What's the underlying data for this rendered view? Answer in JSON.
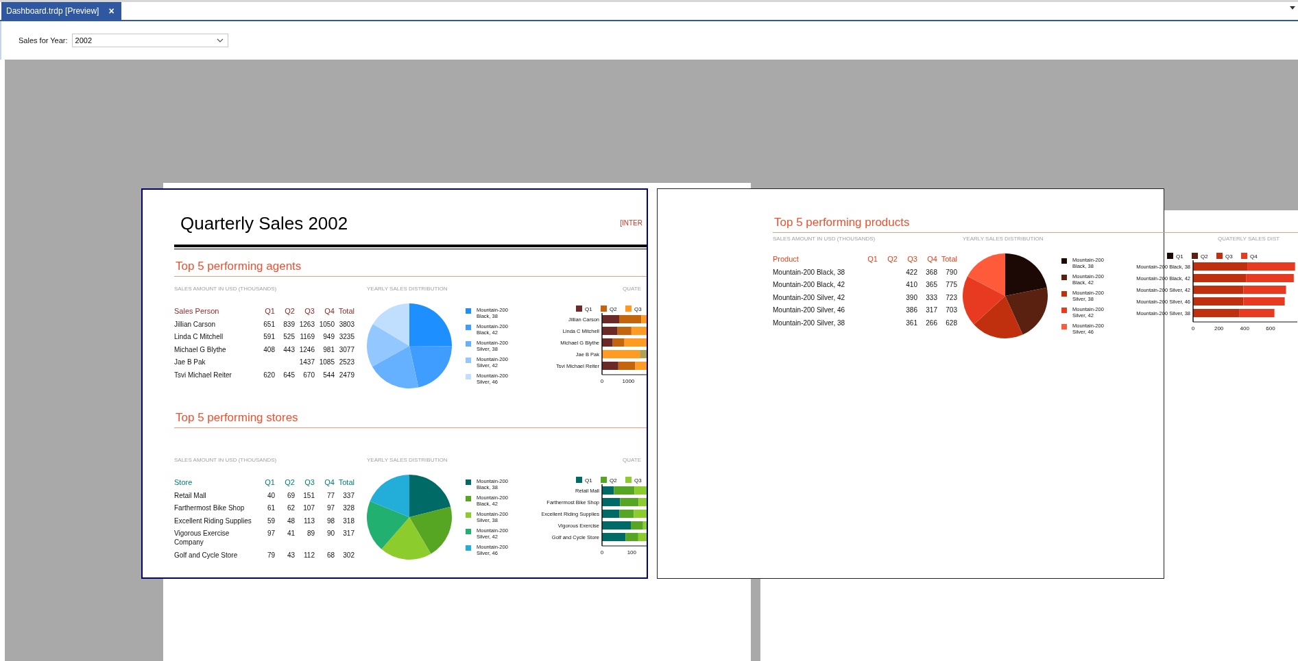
{
  "tab": {
    "label": "Dashboard.trdp [Preview]",
    "close": "×"
  },
  "parameter": {
    "label": "Sales for Year:",
    "value": "2002"
  },
  "page_1": {
    "title": "Quarterly Sales 2002",
    "stamp": "[INTER",
    "sections": [
      {
        "title": "Top 5 performing agents",
        "color": "#8b2a2a",
        "table_caption": "SALES AMOUNT IN USD (THOUSANDS)",
        "columns": [
          "Sales Person",
          "Q1",
          "Q2",
          "Q3",
          "Q4",
          "Total"
        ],
        "rows": [
          {
            "cells": [
              "Jillian  Carson",
              "651",
              "839",
              "1263",
              "1050",
              "3803"
            ]
          },
          {
            "cells": [
              "Linda C Mitchell",
              "591",
              "525",
              "1169",
              "949",
              "3235"
            ]
          },
          {
            "cells": [
              "Michael G Blythe",
              "408",
              "443",
              "1246",
              "981",
              "3077"
            ]
          },
          {
            "cells": [
              "Jae B Pak",
              null,
              null,
              "1437",
              "1085",
              "2523"
            ]
          },
          {
            "cells": [
              "Tsvi Michael Reiter",
              "620",
              "645",
              "670",
              "544",
              "2479"
            ]
          }
        ],
        "pie_caption": "YEARLY SALES DISTRIBUTION",
        "legend": [
          {
            "label": "Mountain-200 Black, 38",
            "color": "#1e8fff"
          },
          {
            "label": "Mountain-200 Black, 42",
            "color": "#3f9dff"
          },
          {
            "label": "Mountain-200 Silver, 38",
            "color": "#66b1ff"
          },
          {
            "label": "Mountain-200 Silver, 42",
            "color": "#92c7ff"
          },
          {
            "label": "Mountain-200 Silver, 46",
            "color": "#c0dfff"
          }
        ],
        "bar_caption": "QUATE",
        "bar_chart": {
          "categories": [
            "Jillian Carson",
            "Linda C Mitchell",
            "Michael G Blythe",
            "Jae B Pak",
            "Tsvi Michael Reiter"
          ],
          "ticks": [
            "0",
            "1000"
          ],
          "series": [
            {
              "name": "Q1",
              "color": "#6b2a28"
            },
            {
              "name": "Q2",
              "color": "#c2650c"
            },
            {
              "name": "Q3",
              "color": "#ff9a22"
            },
            {
              "color": "#b0a052"
            }
          ]
        }
      },
      {
        "title": "Top 5 performing stores",
        "color": "#007b78",
        "table_caption": "SALES AMOUNT IN USD (THOUSANDS)",
        "columns": [
          "Store",
          "Q1",
          "Q2",
          "Q3",
          "Q4",
          "Total"
        ],
        "rows": [
          {
            "cells": [
              "Retail Mall",
              "40",
              "69",
              "151",
              "77",
              "337"
            ]
          },
          {
            "cells": [
              "Farthermost Bike Shop",
              "61",
              "62",
              "107",
              "97",
              "328"
            ]
          },
          {
            "cells": [
              "Excellent Riding Supplies",
              "59",
              "48",
              "113",
              "98",
              "318"
            ]
          },
          {
            "cells": [
              "Vigorous Exercise Company",
              "97",
              "41",
              "89",
              "90",
              "317"
            ]
          },
          {
            "cells": [
              "Golf and Cycle Store",
              "79",
              "43",
              "112",
              "68",
              "302"
            ]
          }
        ],
        "pie_caption": "YEARLY SALES DISTRIBUTION",
        "legend": [
          {
            "label": "Mountain-200 Black, 38",
            "color": "#006a66"
          },
          {
            "label": "Mountain-200 Black, 42",
            "color": "#56a624"
          },
          {
            "label": "Mountain-200 Silver, 38",
            "color": "#8ccc2c"
          },
          {
            "label": "Mountain-200 Silver, 42",
            "color": "#22b070"
          },
          {
            "label": "Mountain-200 Silver, 46",
            "color": "#22aed8"
          }
        ],
        "bar_caption": "QUATE",
        "bar_chart": {
          "categories": [
            "Retail Mall",
            "Farthermost Bike Shop",
            "Excellent Riding Supplies",
            "Vigorous Exercise",
            "Golf and Cycle Store"
          ],
          "ticks": [
            "0",
            "100"
          ],
          "series": [
            {
              "name": "Q1",
              "color": "#006a66"
            },
            {
              "name": "Q2",
              "color": "#56a624"
            },
            {
              "name": "Q3",
              "color": "#8ccc2c"
            }
          ]
        }
      }
    ]
  },
  "page_2": {
    "sections": [
      {
        "title": "Top 5 performing products",
        "color": "#e8401c",
        "table_caption": "SALES AMOUNT IN USD (THOUSANDS)",
        "columns": [
          "Product",
          "Q1",
          "Q2",
          "Q3",
          "Q4",
          "Total"
        ],
        "rows": [
          {
            "cells": [
              "Mountain-200 Black, 38",
              null,
              null,
              "422",
              "368",
              "790"
            ]
          },
          {
            "cells": [
              "Mountain-200 Black, 42",
              null,
              null,
              "410",
              "365",
              "775"
            ]
          },
          {
            "cells": [
              "Mountain-200 Silver, 42",
              null,
              null,
              "390",
              "333",
              "723"
            ]
          },
          {
            "cells": [
              "Mountain-200 Silver, 46",
              null,
              null,
              "386",
              "317",
              "703"
            ]
          },
          {
            "cells": [
              "Mountain-200 Silver, 38",
              null,
              null,
              "361",
              "266",
              "628"
            ]
          }
        ],
        "pie_caption": "YEARLY SALES DISTRIBUTION",
        "legend": [
          {
            "label": "Mountain-200 Black, 38",
            "color": "#1c0805"
          },
          {
            "label": "Mountain-200 Black, 42",
            "color": "#5a2010"
          },
          {
            "label": "Mountain-200 Silver, 38",
            "color": "#c0300f"
          },
          {
            "label": "Mountain-200 Silver, 42",
            "color": "#e83a20"
          },
          {
            "label": "Mountain-200 Silver, 46",
            "color": "#ff5a3a"
          }
        ],
        "bar_caption": "QUATERLY SALES DIST",
        "chart_data": {
          "type": "bar",
          "orientation": "horizontal",
          "stacked": true,
          "legend": "top",
          "categories": [
            "Mountain-200 Black, 38",
            "Mountain-200 Black, 42",
            "Mountain-200 Silver, 42",
            "Mountain-200 Silver, 46",
            "Mountain-200 Silver, 38"
          ],
          "xlim": [
            0,
            850
          ],
          "xticks": [
            0,
            200,
            400,
            600
          ],
          "series": [
            {
              "name": "Q1",
              "color": "#1c0805",
              "values": [
                null,
                null,
                null,
                null,
                null
              ]
            },
            {
              "name": "Q2",
              "color": "#5a2010",
              "values": [
                null,
                null,
                null,
                null,
                null
              ]
            },
            {
              "name": "Q3",
              "color": "#c0300f",
              "values": [
                420,
                410,
                390,
                390,
                360
              ]
            },
            {
              "name": "Q4",
              "color": "#e83a20",
              "values": [
                370,
                370,
                330,
                320,
                270
              ]
            }
          ]
        }
      }
    ]
  }
}
